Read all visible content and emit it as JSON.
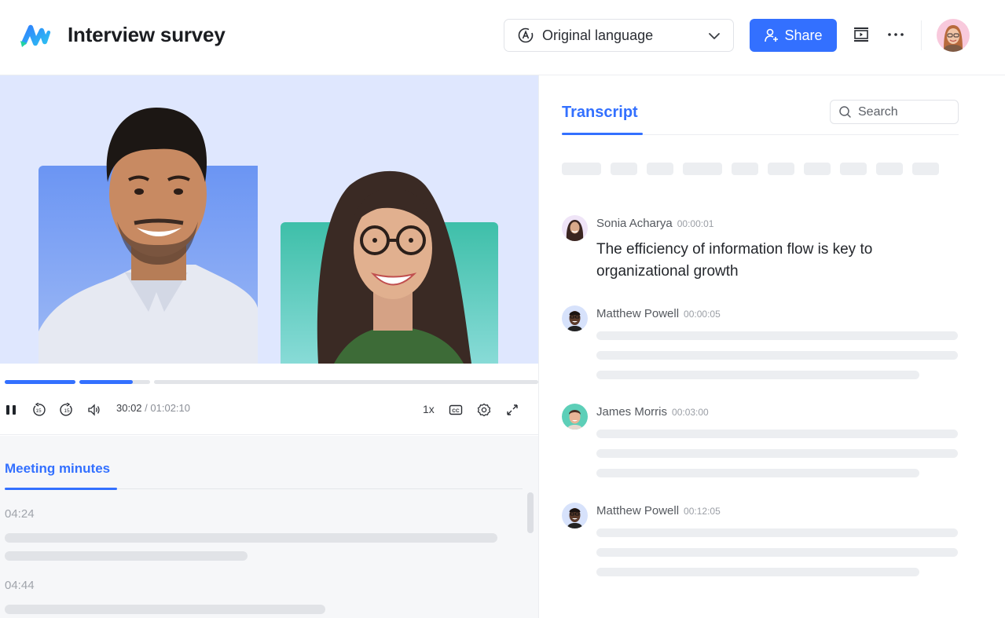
{
  "header": {
    "app_title": "Interview survey",
    "language_select": {
      "value": "Original language"
    },
    "share_label": "Share",
    "brand_color": "#3370ff"
  },
  "player": {
    "current_time": "30:02",
    "separator": " / ",
    "duration": "01:02:10",
    "speed": "1x",
    "progress_fraction": 0.483,
    "skip_back_seconds": "15",
    "skip_forward_seconds": "15",
    "chapters": [
      {
        "filled_fraction": 1.0
      },
      {
        "filled_fraction": 0.76
      },
      {
        "filled_fraction": 0.0
      }
    ]
  },
  "meeting_minutes": {
    "tab_label": "Meeting minutes",
    "items": [
      {
        "time": "04:24"
      },
      {
        "time": "04:44"
      }
    ]
  },
  "transcript": {
    "tab_label": "Transcript",
    "search_placeholder": "Search",
    "chip_count": 10,
    "entries": [
      {
        "speaker": "Sonia Acharya",
        "timestamp": "00:00:01",
        "text": "The efficiency of information flow is key to organizational growth",
        "avatar_bg": "#efe4f7"
      },
      {
        "speaker": "Matthew Powell",
        "timestamp": "00:00:05",
        "text": "",
        "avatar_bg": "#d7e2fb"
      },
      {
        "speaker": "James Morris",
        "timestamp": "00:03:00",
        "text": "",
        "avatar_bg": "#5dcfb8"
      },
      {
        "speaker": "Matthew Powell",
        "timestamp": "00:12:05",
        "text": "",
        "avatar_bg": "#d7e2fb"
      }
    ]
  }
}
